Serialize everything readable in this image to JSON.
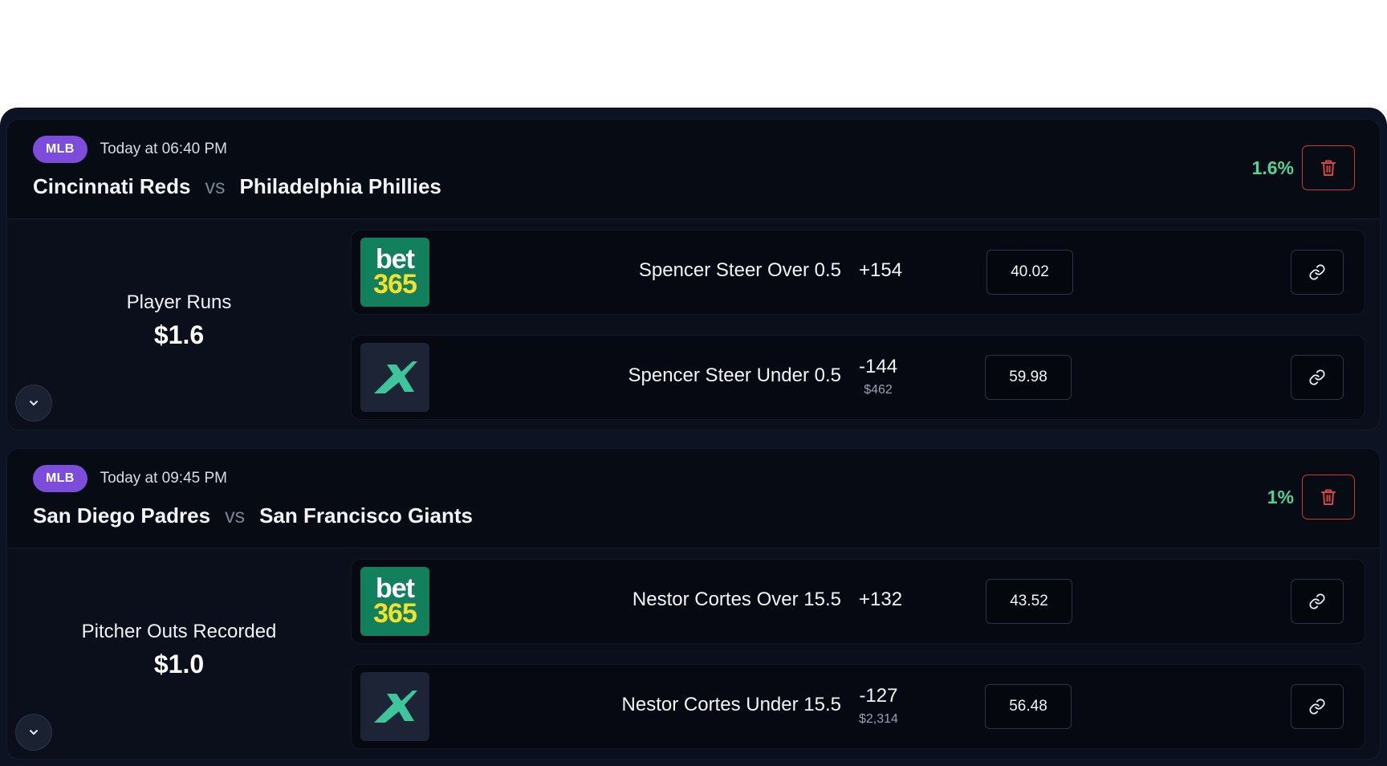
{
  "events": [
    {
      "league": "MLB",
      "time": "Today at 06:40 PM",
      "home_team": "Cincinnati Reds",
      "vs": "vs",
      "away_team": "Philadelphia Phillies",
      "profit_pct": "1.6%",
      "market": "Player Runs",
      "amount": "$1.6",
      "bets": [
        {
          "book": "bet365",
          "logo_top": "bet",
          "logo_bottom": "365",
          "selection": "Spencer Steer Over 0.5",
          "odds": "+154",
          "limit": "",
          "stake": "40.02"
        },
        {
          "book": "x-book",
          "selection": "Spencer Steer Under 0.5",
          "odds": "-144",
          "limit": "$462",
          "stake": "59.98"
        }
      ]
    },
    {
      "league": "MLB",
      "time": "Today at 09:45 PM",
      "home_team": "San Diego Padres",
      "vs": "vs",
      "away_team": "San Francisco Giants",
      "profit_pct": "1%",
      "market": "Pitcher Outs Recorded",
      "amount": "$1.0",
      "bets": [
        {
          "book": "bet365",
          "logo_top": "bet",
          "logo_bottom": "365",
          "selection": "Nestor Cortes Over 15.5",
          "odds": "+132",
          "limit": "",
          "stake": "43.52"
        },
        {
          "book": "x-book",
          "selection": "Nestor Cortes Under 15.5",
          "odds": "-127",
          "limit": "$2,314",
          "stake": "56.48"
        }
      ]
    }
  ],
  "colors": {
    "accent_badge": "#7c4ddb",
    "profit": "#4fd49a",
    "danger": "#c53a3a",
    "bet365_green": "#12805c",
    "bet365_yellow": "#f7e02b",
    "xbook_green": "#3fc59b"
  },
  "icons": {
    "delete": "trash-icon",
    "expand": "chevron-down-icon",
    "open": "link-icon"
  }
}
